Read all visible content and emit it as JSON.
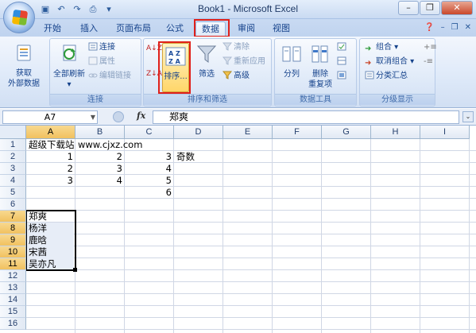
{
  "window": {
    "title": "Book1 - Microsoft Excel"
  },
  "qat": [
    "save-icon",
    "undo-icon",
    "redo-icon",
    "print-preview-icon"
  ],
  "tabs": [
    {
      "label": "开始",
      "active": false
    },
    {
      "label": "插入",
      "active": false
    },
    {
      "label": "页面布局",
      "active": false
    },
    {
      "label": "公式",
      "active": false
    },
    {
      "label": "数据",
      "active": true
    },
    {
      "label": "审阅",
      "active": false
    },
    {
      "label": "视图",
      "active": false
    }
  ],
  "ribbon": {
    "get_external": {
      "line1": "获取",
      "line2": "外部数据"
    },
    "refresh_all": "全部刷新",
    "connections": "连接",
    "properties": "属性",
    "edit_links": "编辑链接",
    "group_connections": "连接",
    "sort_az": "A↓Z",
    "sort_za": "Z↓A",
    "sort": "排序...",
    "filter": "筛选",
    "clear": "清除",
    "reapply": "重新应用",
    "advanced": "高级",
    "group_sort_filter": "排序和筛选",
    "text_to_columns": "分列",
    "remove_duplicates": {
      "line1": "删除",
      "line2": "重复项"
    },
    "group_data_tools": "数据工具",
    "group": "组合",
    "ungroup": "取消组合",
    "subtotal": "分类汇总",
    "group_outline": "分级显示"
  },
  "formula_bar": {
    "name_box": "A7",
    "fx": "fx",
    "content": "郑爽"
  },
  "columns": [
    "A",
    "B",
    "C",
    "D",
    "E",
    "F",
    "G",
    "H",
    "I"
  ],
  "selected_column": "A",
  "rows": [
    "1",
    "2",
    "3",
    "4",
    "5",
    "6",
    "7",
    "8",
    "9",
    "10",
    "11",
    "12",
    "13",
    "14",
    "15",
    "16"
  ],
  "selected_rows": [
    "7",
    "8",
    "9",
    "10",
    "11"
  ],
  "cells": {
    "A1": "超级下载站",
    "B1": "www.cjxz.com",
    "A2": "1",
    "B2": "2",
    "C2": "3",
    "D2": "奇数",
    "A3": "2",
    "B3": "3",
    "C3": "4",
    "A4": "3",
    "B4": "4",
    "C4": "5",
    "C5": "6",
    "A7": "郑爽",
    "A8": "杨洋",
    "A9": "鹿晗",
    "A10": "宋茜",
    "A11": "吴亦凡"
  },
  "colors": {
    "highlight": "#e0201a",
    "selection": "#f1c15f"
  }
}
